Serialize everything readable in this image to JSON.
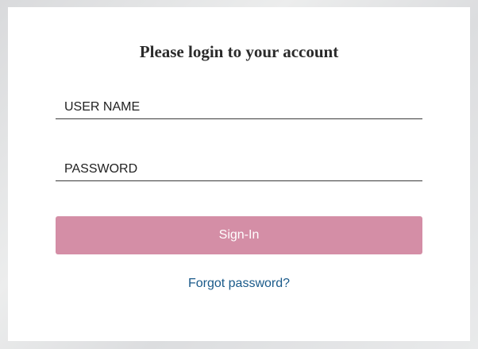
{
  "login": {
    "title": "Please login to your account",
    "username_placeholder": "USER NAME",
    "username_value": "",
    "password_placeholder": "PASSWORD",
    "password_value": "",
    "signin_label": "Sign-In",
    "forgot_label": "Forgot password?"
  },
  "colors": {
    "accent_button": "#d48ea6",
    "link": "#1a5a8a",
    "card_background": "#ffffff",
    "page_background": "#e4e5e7"
  }
}
